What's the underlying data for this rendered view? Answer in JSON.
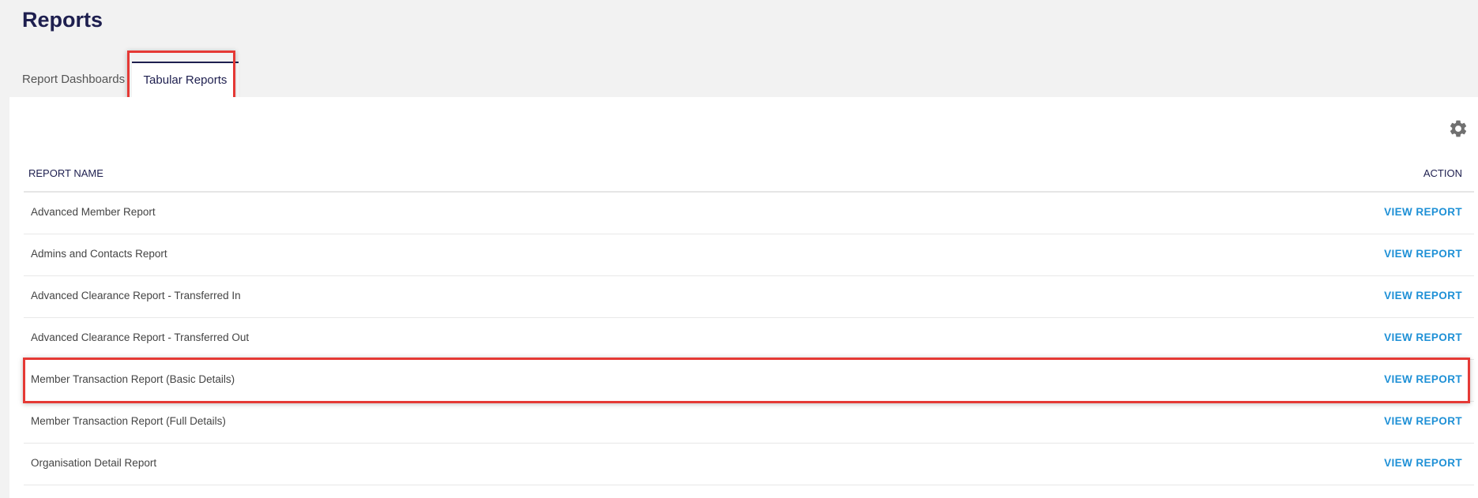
{
  "page": {
    "title": "Reports"
  },
  "tabs": [
    {
      "label": "Report Dashboards",
      "active": false
    },
    {
      "label": "Tabular Reports",
      "active": true
    }
  ],
  "toolbar": {
    "settings_icon": "gear-icon"
  },
  "table": {
    "headers": {
      "name": "REPORT NAME",
      "action": "ACTION"
    },
    "rows": [
      {
        "name": "Advanced Member Report",
        "action": "VIEW REPORT"
      },
      {
        "name": "Admins and Contacts Report",
        "action": "VIEW REPORT"
      },
      {
        "name": "Advanced Clearance Report - Transferred In",
        "action": "VIEW REPORT"
      },
      {
        "name": "Advanced Clearance Report - Transferred Out",
        "action": "VIEW REPORT"
      },
      {
        "name": "Member Transaction Report (Basic Details)",
        "action": "VIEW REPORT"
      },
      {
        "name": "Member Transaction Report (Full Details)",
        "action": "VIEW REPORT"
      },
      {
        "name": "Organisation Detail Report",
        "action": "VIEW REPORT"
      }
    ]
  },
  "colors": {
    "title": "#1e1f4f",
    "link": "#1e90d6",
    "highlight": "#e53935"
  }
}
